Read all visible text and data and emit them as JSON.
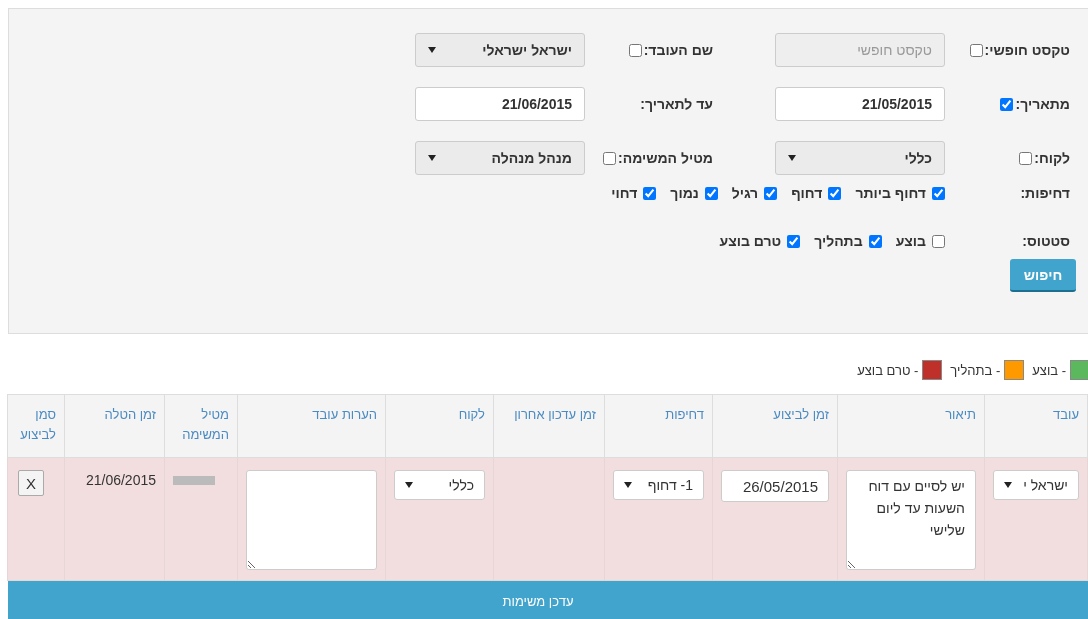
{
  "filters": {
    "free_text": {
      "label": "טקסט חופשי:",
      "checked": false,
      "placeholder": "טקסט חופשי",
      "disabled": true
    },
    "employee": {
      "label": "שם העובד:",
      "checked": false,
      "value": "ישראל ישראלי"
    },
    "from_date": {
      "label": "מתאריך:",
      "checked": true,
      "value": "21/05/2015"
    },
    "to_date": {
      "label": "עד לתאריך:",
      "value": "21/06/2015"
    },
    "customer": {
      "label": "לקוח:",
      "checked": false,
      "value": "כללי"
    },
    "assigner": {
      "label": "מטיל המשימה:",
      "checked": false,
      "value": "מנהל מנהלה"
    },
    "urgency": {
      "label": "דחיפות:",
      "options": [
        {
          "label": "דחוף ביותר",
          "checked": true
        },
        {
          "label": "דחוף",
          "checked": true
        },
        {
          "label": "רגיל",
          "checked": true
        },
        {
          "label": "נמוך",
          "checked": true
        },
        {
          "label": "דחוי",
          "checked": true
        }
      ]
    },
    "status": {
      "label": "סטטוס:",
      "options": [
        {
          "label": "בוצע",
          "checked": false
        },
        {
          "label": "בתהליך",
          "checked": true
        },
        {
          "label": "טרם בוצע",
          "checked": true
        }
      ]
    },
    "search_button": "חיפוש"
  },
  "legend": [
    {
      "label": "- בוצע",
      "color": "#5cb85c"
    },
    {
      "label": "- בתהליך",
      "color": "#ff9900"
    },
    {
      "label": "- טרם בוצע",
      "color": "#c0302a"
    }
  ],
  "table": {
    "columns": [
      "עובד",
      "תיאור",
      "זמן לביצוע",
      "דחיפות",
      "זמן עדכון אחרון",
      "לקוח",
      "הערות עובד",
      "מטיל המשימה",
      "זמן הטלה",
      "סמן לביצוע"
    ],
    "rows": [
      {
        "cells": [
          {
            "kind": "select",
            "value": "ישראל י"
          },
          {
            "kind": "textarea",
            "value": "יש לסיים עם דוח השעות עד ליום שלישי"
          },
          {
            "kind": "date",
            "value": "26/05/2015"
          },
          {
            "kind": "select",
            "value": "1- דחוף"
          },
          {
            "kind": "empty"
          },
          {
            "kind": "select",
            "value": "כללי"
          },
          {
            "kind": "textarea"
          },
          {
            "kind": "redacted"
          },
          {
            "kind": "text",
            "value": "21/06/2015"
          },
          {
            "kind": "button",
            "value": "X"
          }
        ]
      }
    ]
  },
  "update_button": "עדכן משימות"
}
